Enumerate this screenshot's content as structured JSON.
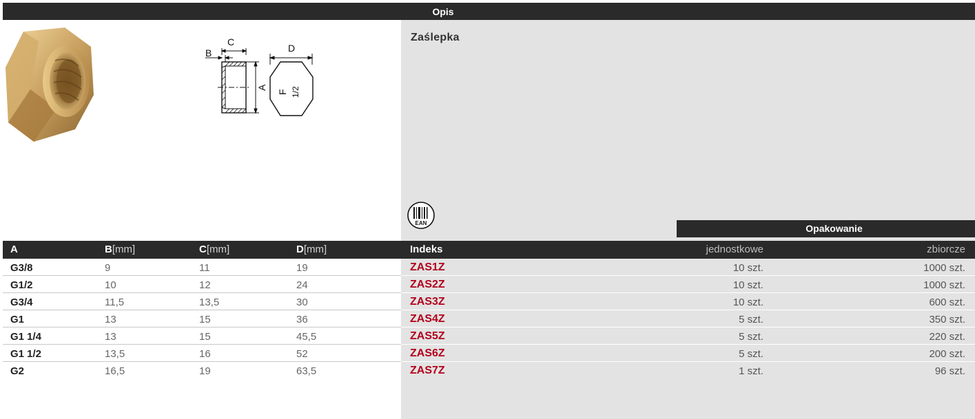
{
  "header": {
    "title": "Opis"
  },
  "product": {
    "name": "Zaślepka"
  },
  "drawing_labels": {
    "a": "A",
    "b": "B",
    "c": "C",
    "d": "D",
    "f": "F",
    "half": "1/2"
  },
  "ean_label": "EAN",
  "packaging_header": "Opakowanie",
  "columns": {
    "a": "A",
    "b": "B",
    "b_unit": "[mm]",
    "c": "C",
    "c_unit": "[mm]",
    "d": "D",
    "d_unit": "[mm]",
    "index": "Indeks",
    "unit_pack": "jednostkowe",
    "bulk_pack": "zbiorcze"
  },
  "rows": [
    {
      "a": "G3/8",
      "b": "9",
      "c": "11",
      "d": "19",
      "index": "ZAS1Z",
      "unit": "10 szt.",
      "bulk": "1000 szt."
    },
    {
      "a": "G1/2",
      "b": "10",
      "c": "12",
      "d": "24",
      "index": "ZAS2Z",
      "unit": "10 szt.",
      "bulk": "1000 szt."
    },
    {
      "a": "G3/4",
      "b": "11,5",
      "c": "13,5",
      "d": "30",
      "index": "ZAS3Z",
      "unit": "10 szt.",
      "bulk": "600 szt."
    },
    {
      "a": "G1",
      "b": "13",
      "c": "15",
      "d": "36",
      "index": "ZAS4Z",
      "unit": "5 szt.",
      "bulk": "350 szt."
    },
    {
      "a": "G1 1/4",
      "b": "13",
      "c": "15",
      "d": "45,5",
      "index": "ZAS5Z",
      "unit": "5 szt.",
      "bulk": "220 szt."
    },
    {
      "a": "G1 1/2",
      "b": "13,5",
      "c": "16",
      "d": "52",
      "index": "ZAS6Z",
      "unit": "5 szt.",
      "bulk": "200 szt."
    },
    {
      "a": "G2",
      "b": "16,5",
      "c": "19",
      "d": "63,5",
      "index": "ZAS7Z",
      "unit": "1 szt.",
      "bulk": "96 szt."
    }
  ]
}
